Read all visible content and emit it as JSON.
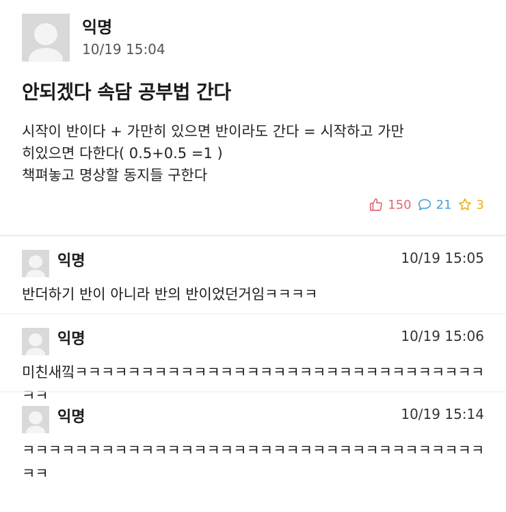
{
  "post": {
    "author": "익명",
    "time": "10/19 15:04",
    "title": "안되겠다 속담 공부법 간다",
    "body": "시작이 반이다 + 가만히 있으면 반이라도 간다 = 시작하고 가만\n히있으면 다한다( 0.5+0.5 =1 )\n책펴놓고 명상할 동지들 구한다",
    "likes": "150",
    "comments": "21",
    "scraps": "3"
  },
  "comments": [
    {
      "author": "익명",
      "time": "10/19 15:05",
      "text": "반더하기 반이 아니라 반의 반이었던거임ㅋㅋㅋㅋ"
    },
    {
      "author": "익명",
      "time": "10/19 15:06",
      "text": "미친새낔ㅋㅋㅋㅋㅋㅋㅋㅋㅋㅋㅋㅋㅋㅋㅋㅋㅋㅋㅋㅋㅋㅋㅋㅋㅋㅋㅋㅋㅋㅋㅋㅋㅋ"
    },
    {
      "author": "익명",
      "time": "10/19 15:14",
      "text": "ㅋㅋㅋㅋㅋㅋㅋㅋㅋㅋㅋㅋㅋㅋㅋㅋㅋㅋㅋㅋㅋㅋㅋㅋㅋㅋㅋㅋㅋㅋㅋㅋㅋㅋㅋㅋㅋ"
    }
  ],
  "colors": {
    "like": "#e0686f",
    "comment": "#4aa3d6",
    "scrap": "#e8b20c"
  }
}
